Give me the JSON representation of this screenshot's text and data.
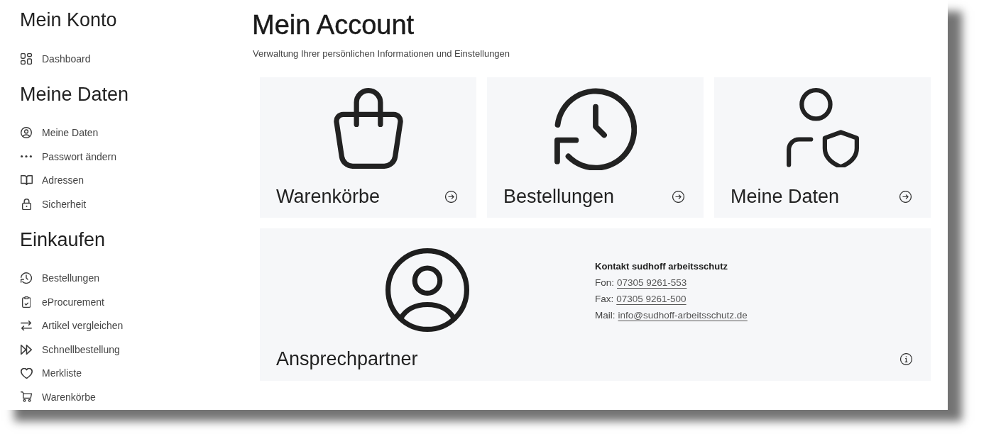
{
  "sidebar": {
    "sections": [
      {
        "heading": "Mein Konto",
        "items": [
          {
            "label": "Dashboard",
            "kind": "dashboard"
          }
        ]
      },
      {
        "heading": "Meine Daten",
        "items": [
          {
            "label": "Meine Daten",
            "kind": "profile"
          },
          {
            "label": "Passwort ändern",
            "kind": "password"
          },
          {
            "label": "Adressen",
            "kind": "addresses"
          },
          {
            "label": "Sicherheit",
            "kind": "security"
          }
        ]
      },
      {
        "heading": "Einkaufen",
        "items": [
          {
            "label": "Bestellungen",
            "kind": "orders"
          },
          {
            "label": "eProcurement",
            "kind": "procurement"
          },
          {
            "label": "Artikel vergleichen",
            "kind": "compare"
          },
          {
            "label": "Schnellbestellung",
            "kind": "quickorder"
          },
          {
            "label": "Merkliste",
            "kind": "wishlist"
          },
          {
            "label": "Warenkörbe",
            "kind": "carts"
          }
        ]
      }
    ]
  },
  "header": {
    "title": "Mein Account",
    "subtitle": "Verwaltung Ihrer persönlichen Informationen und Einstellungen"
  },
  "tiles": [
    {
      "title": "Warenkörbe",
      "kind": "carts"
    },
    {
      "title": "Bestellungen",
      "kind": "orders"
    },
    {
      "title": "Meine Daten",
      "kind": "profile"
    }
  ],
  "contact_card": {
    "title": "Ansprechpartner",
    "heading": "Kontakt sudhoff arbeitsschutz",
    "lines": [
      {
        "label": "Fon:",
        "link": "07305 9261-553"
      },
      {
        "label": "Fax:",
        "link": "07305 9261-500"
      },
      {
        "label": "Mail:",
        "link": "info@sudhoff-arbeitsschutz.de"
      }
    ]
  }
}
